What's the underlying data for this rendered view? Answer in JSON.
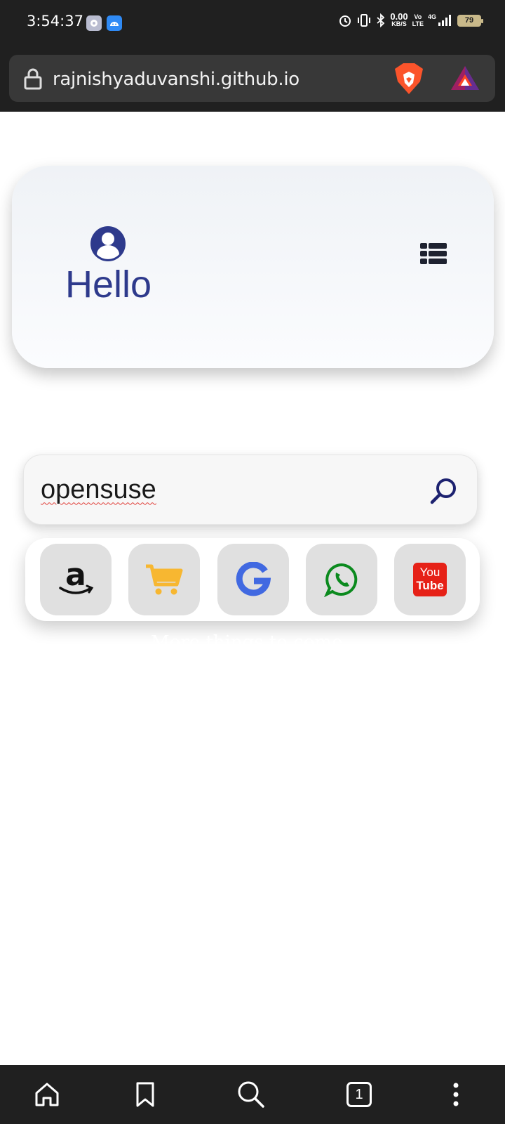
{
  "status_bar": {
    "time": "3:54:37",
    "speed_value": "0.00",
    "speed_unit": "KB/S",
    "volte_top": "Vo",
    "volte_bottom": "LTE",
    "network": "4G",
    "battery": "79",
    "icons": [
      "settings-icon",
      "android-icon",
      "alarm-icon",
      "vibrate-icon",
      "bluetooth-icon",
      "signal-icon",
      "battery-icon"
    ]
  },
  "browser": {
    "url": "rajnishyaduvanshi.github.io",
    "icons": [
      "lock-icon",
      "brave-lion-icon",
      "bat-rewards-icon"
    ]
  },
  "hero": {
    "greeting": "Hello",
    "icons": [
      "user-icon",
      "menu-list-icon"
    ],
    "colors": {
      "accent": "#2e3a8c"
    }
  },
  "search": {
    "value": "opensuse",
    "icon": "search-icon"
  },
  "shortcuts": [
    {
      "name": "amazon",
      "icon": "amazon-icon"
    },
    {
      "name": "shopping-cart",
      "icon": "cart-icon"
    },
    {
      "name": "google",
      "icon": "google-icon"
    },
    {
      "name": "whatsapp",
      "icon": "whatsapp-icon"
    },
    {
      "name": "youtube",
      "icon": "youtube-icon",
      "label_top": "You",
      "label_bottom": "Tube"
    }
  ],
  "footer_text": "More things to come..",
  "bottom_nav": {
    "tab_count": "1",
    "icons": [
      "home-icon",
      "bookmark-icon",
      "search-icon",
      "tabs-icon",
      "more-options-icon"
    ]
  }
}
